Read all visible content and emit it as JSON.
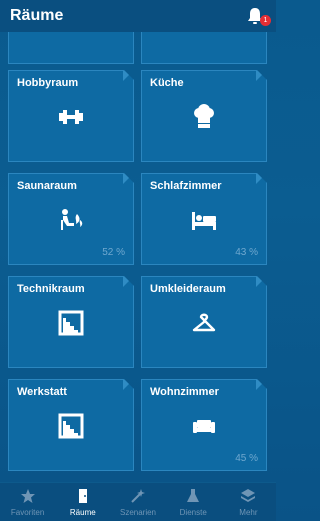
{
  "header": {
    "title": "Räume",
    "badge_count": "1"
  },
  "rooms": [
    {
      "name": "",
      "percent": ""
    },
    {
      "name": "",
      "percent": ""
    },
    {
      "name": "Hobbyraum",
      "icon": "dumbbell-icon",
      "percent": ""
    },
    {
      "name": "Küche",
      "icon": "chef-hat-icon",
      "percent": ""
    },
    {
      "name": "Saunaraum",
      "icon": "sauna-icon",
      "percent": "52 %"
    },
    {
      "name": "Schlafzimmer",
      "icon": "bed-icon",
      "percent": "43 %"
    },
    {
      "name": "Technikraum",
      "icon": "room-plan-icon",
      "percent": ""
    },
    {
      "name": "Umkleideraum",
      "icon": "hanger-icon",
      "percent": ""
    },
    {
      "name": "Werkstatt",
      "icon": "room-plan-icon",
      "percent": ""
    },
    {
      "name": "Wohnzimmer",
      "icon": "sofa-icon",
      "percent": "45 %"
    }
  ],
  "nav": [
    {
      "label": "Favoriten",
      "icon": "star-icon"
    },
    {
      "label": "Räume",
      "icon": "door-icon",
      "active": true
    },
    {
      "label": "Szenarien",
      "icon": "magic-wand-icon"
    },
    {
      "label": "Dienste",
      "icon": "flask-icon"
    },
    {
      "label": "Mehr",
      "icon": "layers-icon"
    }
  ],
  "colors": {
    "background": "#0b5d91",
    "tile": "#0e6aa3",
    "header": "#0a4f80",
    "badge": "#e52e34",
    "percent_text": "#6fa8cf",
    "nav_inactive": "#6f95b5"
  }
}
